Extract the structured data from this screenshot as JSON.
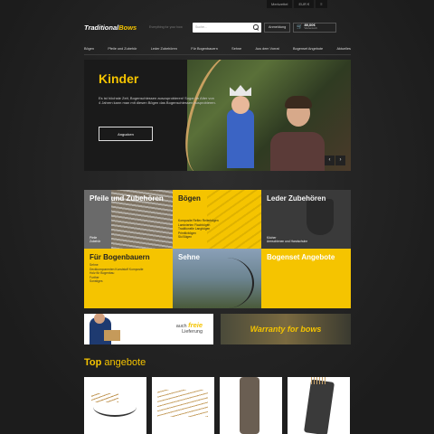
{
  "utilbar": {
    "wishlist": "Merkzettel",
    "currency": "EUR €",
    "extra": "≡"
  },
  "header": {
    "logo_main": "Traditional",
    "logo_accent": "Bows",
    "tagline": "Everything for your bow",
    "search_placeholder": "Suche...",
    "login": "Anmeldung",
    "cart_amount": "89,00€",
    "cart_sub": "Warenkorb"
  },
  "nav": [
    "Bögen",
    "Pfeile und Zubehör",
    "Leder Zubehören",
    "Für Bogenbauern",
    "Sehne",
    "Aus dem Vorrat",
    "Bogenset Angebote",
    "Aktuelles"
  ],
  "hero": {
    "title": "Kinder",
    "text": "Es ist höchste Zeit, Bogenschiessen auszuprobieren! Sogar im Alter von 4 Jahren kann man mit diesen Bögen das Bogenschiessen ausprobieren.",
    "cta": "Angucken",
    "prev": "‹",
    "next": "›"
  },
  "tiles": [
    {
      "title": "Pfeile und Zubehören",
      "links": [
        "Pfeile",
        "Zubehör"
      ]
    },
    {
      "title": "Bögen",
      "links": [
        "Komposite Reflex Reiterbögen",
        "Laminierten Flachbögen",
        "Traditionelle Langbögen",
        "Primitivbögen",
        "Ski Bögen"
      ]
    },
    {
      "title": "Leder Zubehören",
      "links": [
        "Köcher",
        "Armschienen und Handschuhe"
      ]
    },
    {
      "title": "Für Bogenbauern",
      "links": [
        "Sehne",
        "Deckkomponenten Kunststoff Komposite",
        "Holz für Bogenbau",
        "Further",
        "Sonstiges"
      ]
    },
    {
      "title": "Sehne",
      "links": []
    },
    {
      "title": "Bogenset Angebote",
      "links": []
    }
  ],
  "banners": {
    "delivery_prefix": "auch",
    "delivery_bold": "freie",
    "delivery_line2": "Lieferung",
    "warranty": "Warranty for bows"
  },
  "top": {
    "word1": "Top",
    "word2": "angebote"
  },
  "colors": {
    "accent": "#f5c400",
    "bg": "#232323"
  }
}
